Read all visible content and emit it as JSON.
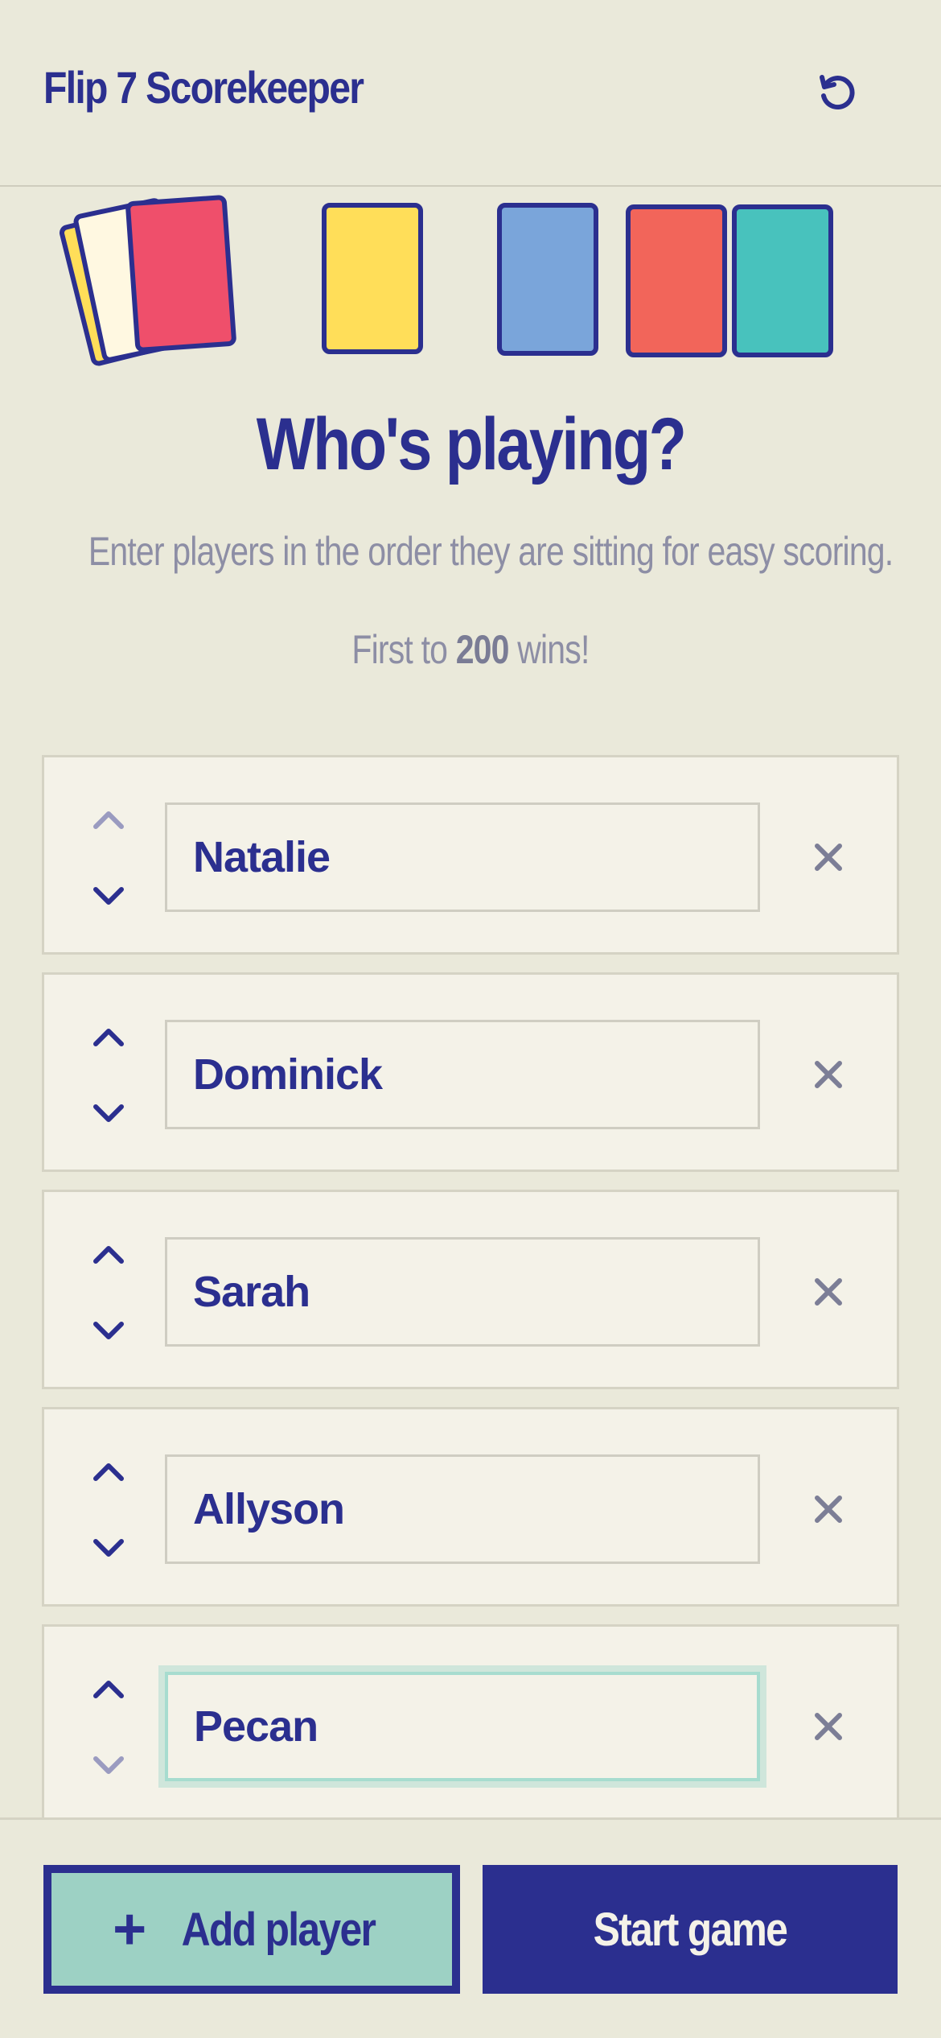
{
  "header": {
    "title": "Flip 7 Scorekeeper",
    "reset_icon": "reset-icon"
  },
  "intro": {
    "title": "Who's playing?",
    "subtitle": "Enter players in the order they are sitting for easy scoring.",
    "goal_prefix": "First to ",
    "goal_score": "200",
    "goal_suffix": " wins!"
  },
  "players": [
    {
      "name": "Natalie",
      "up_disabled": true,
      "down_disabled": false,
      "focused": false
    },
    {
      "name": "Dominick",
      "up_disabled": false,
      "down_disabled": false,
      "focused": false
    },
    {
      "name": "Sarah",
      "up_disabled": false,
      "down_disabled": false,
      "focused": false
    },
    {
      "name": "Allyson",
      "up_disabled": false,
      "down_disabled": false,
      "focused": false
    },
    {
      "name": "Pecan",
      "up_disabled": false,
      "down_disabled": true,
      "focused": true
    }
  ],
  "footer": {
    "add_label": "Add player",
    "add_icon": "+",
    "start_label": "Start game"
  },
  "colors": {
    "brand": "#2B2F8F",
    "background": "#EAE9DA",
    "muted": "#8D8EA5",
    "add_button": "#9DD1C4",
    "card_yellow": "#FFDE59",
    "card_blue": "#7AA5DA",
    "card_orange": "#F2655A",
    "card_teal": "#48C2BD",
    "card_red": "#EF4F6B",
    "card_cream": "#FFF8E1"
  }
}
